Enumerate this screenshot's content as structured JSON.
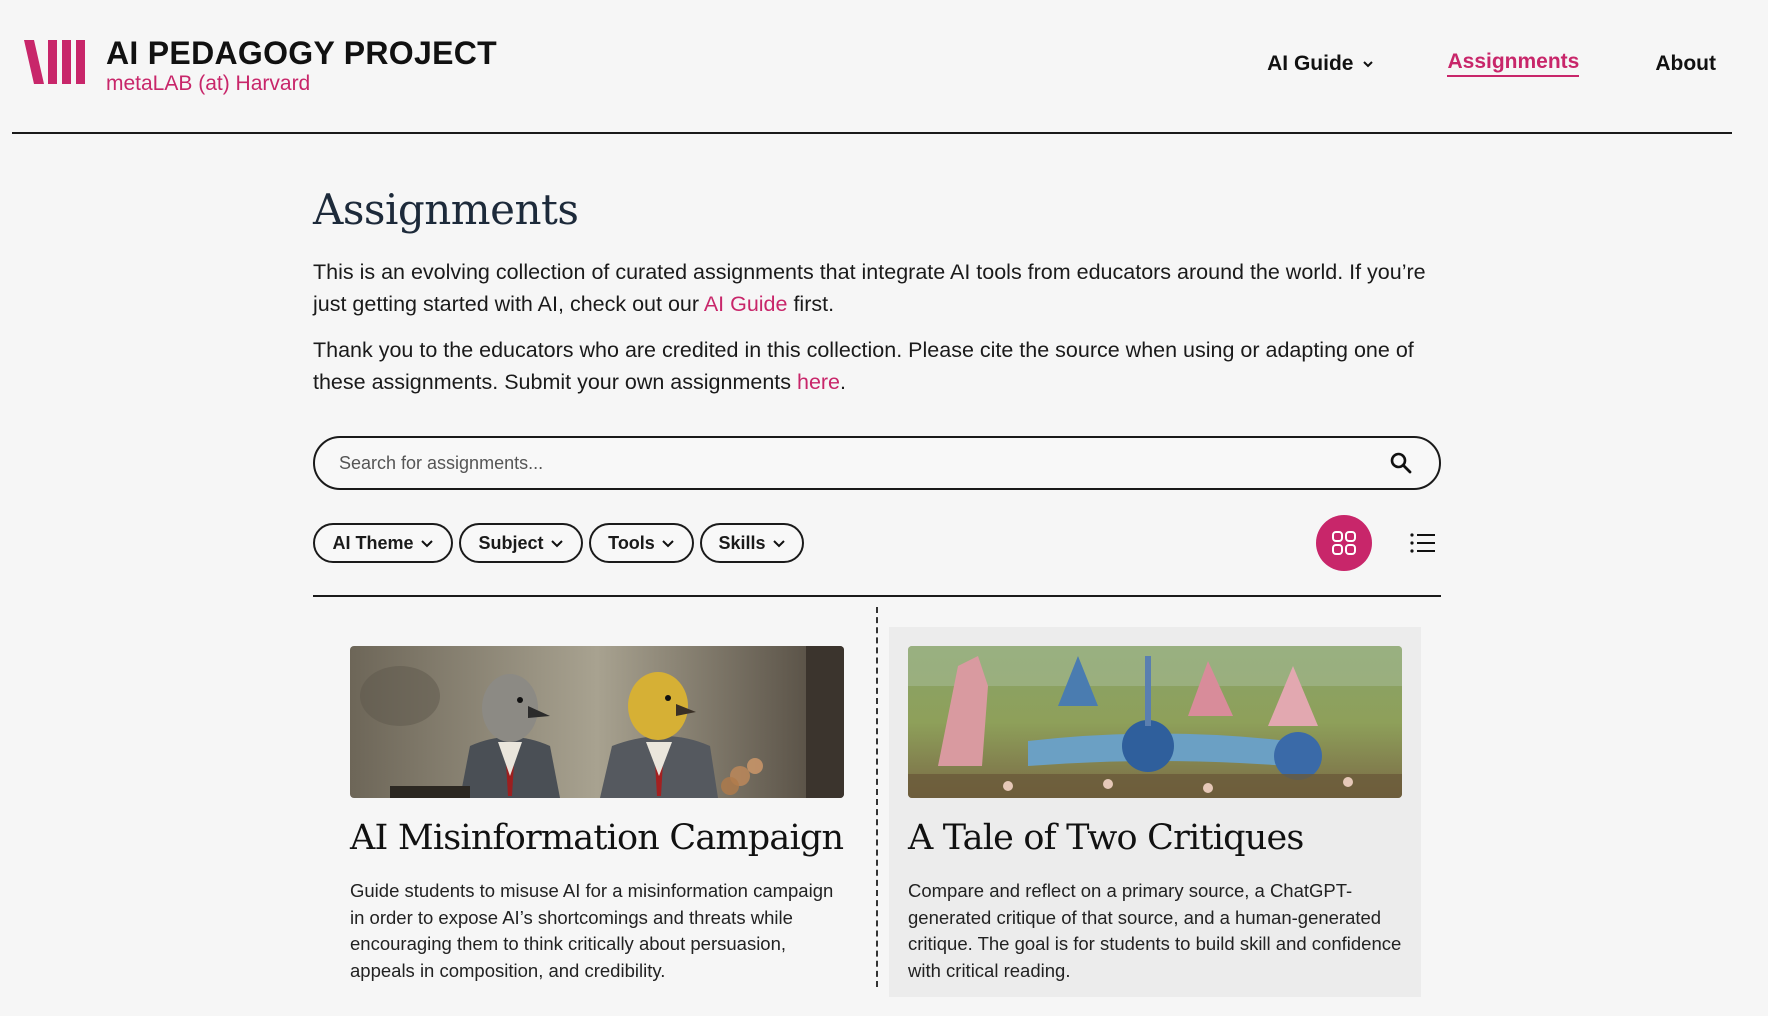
{
  "brand": {
    "title": "AI PEDAGOGY PROJECT",
    "subtitle": "metaLAB (at) Harvard",
    "accent": "#c8266a"
  },
  "nav": {
    "guide": "AI Guide",
    "assignments": "Assignments",
    "about": "About"
  },
  "page": {
    "title": "Assignments",
    "intro1_before": "This is an evolving collection of curated assignments that integrate AI tools from educators around the world. If you’re just getting started with AI, check out our ",
    "intro1_link": "AI Guide",
    "intro1_after": " first.",
    "intro2_before": "Thank you to the educators who are credited in this collection. Please cite the source when using or adapting one of these assignments. Submit your own assignments ",
    "intro2_link": "here",
    "intro2_after": "."
  },
  "search": {
    "placeholder": "Search for assignments...",
    "icon": "search-icon"
  },
  "filters": [
    "AI Theme",
    "Subject",
    "Tools",
    "Skills"
  ],
  "view_toggle": {
    "active": "grid",
    "grid_icon": "grid-view-icon",
    "list_icon": "list-view-icon"
  },
  "cards": [
    {
      "title": "AI Misinformation Campaign",
      "description": "Guide students to misuse AI for a misinformation campaign in order to expose AI’s shortcomings and threats while encouraging them to think critically about persuasion, appeals in composition, and credibility."
    },
    {
      "title": "A Tale of Two Critiques",
      "description": "Compare and reflect on a primary source, a ChatGPT-generated critique of that source, and a human-generated critique. The goal is for students to build skill and confidence with critical reading."
    }
  ]
}
